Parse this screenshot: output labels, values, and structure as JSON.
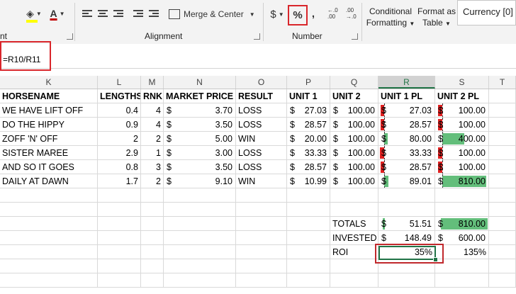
{
  "ribbon": {
    "font_group_tail": "nt",
    "alignment_label": "Alignment",
    "merge_center_label": "Merge & Center",
    "number_label": "Number",
    "currency_symbol": "$",
    "percent_symbol": "%",
    "comma_symbol": ",",
    "increase_decimal_top": "←.0",
    "increase_decimal_bottom": ".00",
    "decrease_decimal_top": ".00",
    "decrease_decimal_bottom": "→.0",
    "conditional_formatting_line1": "Conditional",
    "conditional_formatting_line2": "Formatting",
    "format_as_table_line1": "Format as",
    "format_as_table_line2": "Table",
    "style_box_label": "Currency [0]",
    "font_color": "#c00000",
    "fill_color": "#ffff00"
  },
  "formula": {
    "text": "=R10/R11"
  },
  "columns": [
    "K",
    "L",
    "M",
    "N",
    "O",
    "P",
    "Q",
    "R",
    "S",
    "T"
  ],
  "selected_column": "R",
  "header_row": {
    "horsename": "HORSENAME",
    "lengths": "LENGTHS",
    "rnk": "RNK",
    "market_price": "MARKET PRICE",
    "result": "RESULT",
    "unit1": "UNIT 1",
    "unit2": "UNIT 2",
    "unit1pl": "UNIT 1 PL",
    "unit2pl": "UNIT 2 PL"
  },
  "rows": [
    {
      "name": "WE HAVE LIFT OFF",
      "lengths": "0.4",
      "rnk": "4",
      "price": "3.70",
      "result": "LOSS",
      "unit1": "27.03",
      "unit2": "100.00",
      "pl1": "27.03",
      "pl1_neg": true,
      "pl2": "100.00",
      "pl2_neg": true
    },
    {
      "name": "DO THE HIPPY",
      "lengths": "0.9",
      "rnk": "4",
      "price": "3.50",
      "result": "LOSS",
      "unit1": "28.57",
      "unit2": "100.00",
      "pl1": "28.57",
      "pl1_neg": true,
      "pl2": "100.00",
      "pl2_neg": true
    },
    {
      "name": "ZOFF 'N' OFF",
      "lengths": "2",
      "rnk": "2",
      "price": "5.00",
      "result": "WIN",
      "unit1": "20.00",
      "unit2": "100.00",
      "pl1": "80.00",
      "pl1_neg": false,
      "pl2": "400.00",
      "pl2_neg": false
    },
    {
      "name": "SISTER MAREE",
      "lengths": "2.9",
      "rnk": "1",
      "price": "3.00",
      "result": "LOSS",
      "unit1": "33.33",
      "unit2": "100.00",
      "pl1": "33.33",
      "pl1_neg": true,
      "pl2": "100.00",
      "pl2_neg": true
    },
    {
      "name": "AND SO IT GOES",
      "lengths": "0.8",
      "rnk": "3",
      "price": "3.50",
      "result": "LOSS",
      "unit1": "28.57",
      "unit2": "100.00",
      "pl1": "28.57",
      "pl1_neg": true,
      "pl2": "100.00",
      "pl2_neg": true
    },
    {
      "name": "DAILY AT DAWN",
      "lengths": "1.7",
      "rnk": "2",
      "price": "9.10",
      "result": "WIN",
      "unit1": "10.99",
      "unit2": "100.00",
      "pl1": "89.01",
      "pl1_neg": false,
      "pl2": "810.00",
      "pl2_neg": false
    }
  ],
  "pl1_values": [
    -27.03,
    -28.57,
    80.0,
    -33.33,
    -28.57,
    89.01
  ],
  "pl2_values": [
    -100,
    -100,
    400,
    -100,
    -100,
    810
  ],
  "summary": {
    "totals_label": "TOTALS",
    "totals_pl1": "51.51",
    "totals_pl2": "810.00",
    "invested_label": "INVESTED",
    "invested_pl1": "148.49",
    "invested_pl2": "600.00",
    "roi_label": "ROI",
    "roi_pl1": "35%",
    "roi_pl2": "135%"
  },
  "currency": "$"
}
